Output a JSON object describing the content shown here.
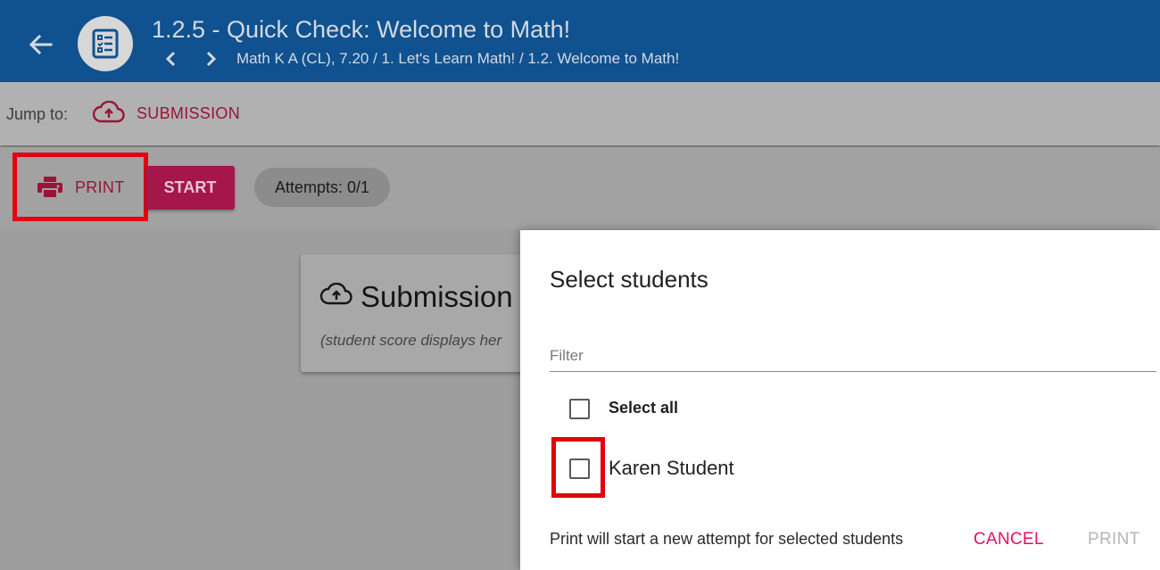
{
  "header": {
    "title": "1.2.5 - Quick Check: Welcome to Math!",
    "breadcrumb": "Math K A (CL), 7.20 / 1. Let's Learn Math! / 1.2. Welcome to Math!",
    "icons": [
      "arrow-left-icon",
      "assignment-icon",
      "chevron-left-icon",
      "chevron-right-icon"
    ]
  },
  "jumpbar": {
    "label": "Jump to:",
    "link_label": "SUBMISSION",
    "link_icon": "cloud-upload-icon"
  },
  "toolbar": {
    "print_label": "PRINT",
    "print_icon": "printer-icon",
    "start_label": "START",
    "attempts": "Attempts: 0/1"
  },
  "submission_card": {
    "title": "Submission",
    "note": "(student score displays her",
    "icon": "cloud-upload-icon"
  },
  "dialog": {
    "title": "Select students",
    "filter_placeholder": "Filter",
    "select_all_label": "Select all",
    "students": [
      {
        "name": "Karen Student",
        "checked": false
      }
    ],
    "note": "Print will start a new attempt for selected students",
    "cancel_label": "CANCEL",
    "print_label": "PRINT"
  },
  "colors": {
    "header_bg": "#10518f",
    "accent": "#9b1437",
    "start_bg": "#a5164a",
    "cancel": "#e0115f",
    "highlight": "#e3000f"
  }
}
